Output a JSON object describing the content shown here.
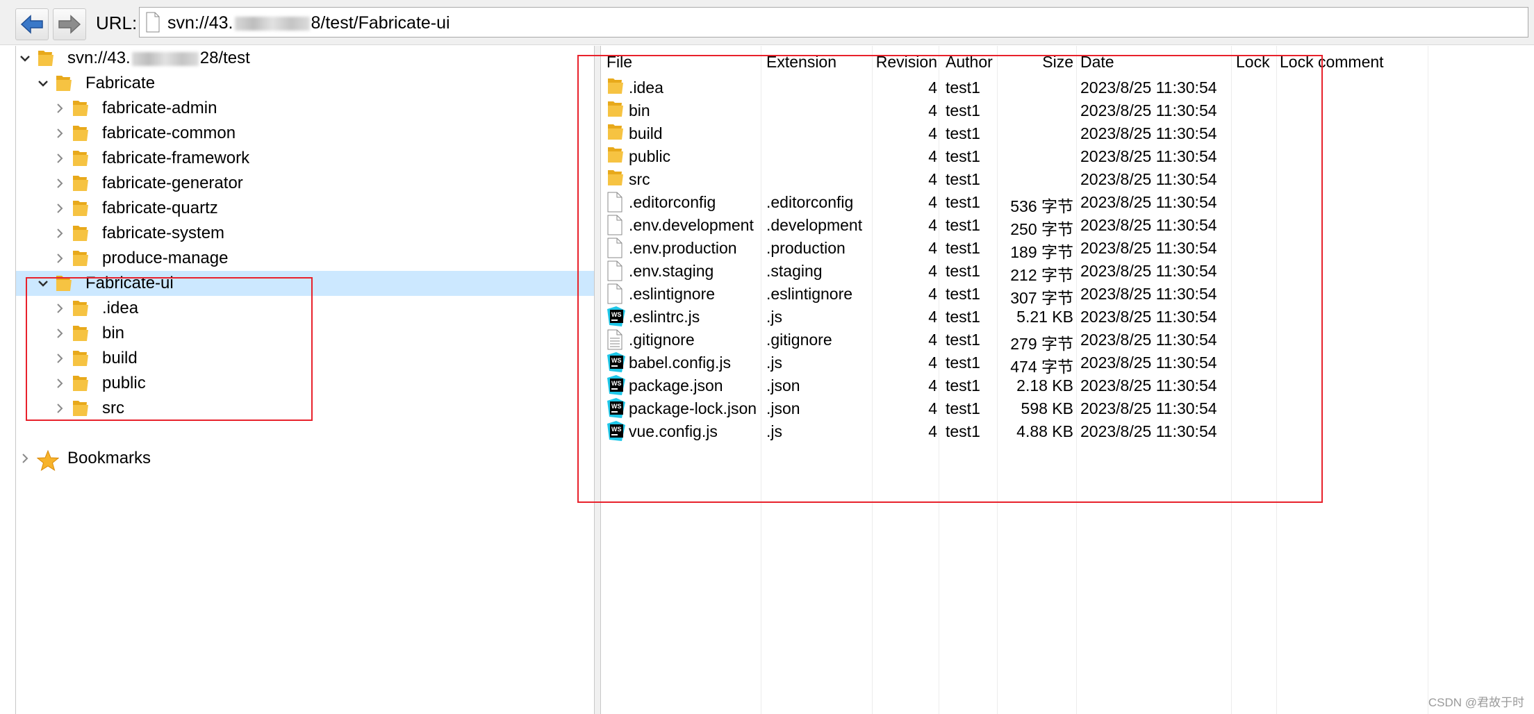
{
  "toolbar": {
    "back_icon": "arrow-left-icon",
    "forward_icon": "arrow-right-icon",
    "url_label": "URL:",
    "url_prefix": "svn://43.",
    "url_suffix": "8/test/Fabricate-ui"
  },
  "tree": {
    "root": "svn://43.",
    "root_suffix": "28/test",
    "fabricate": "Fabricate",
    "fabricate_children": [
      "fabricate-admin",
      "fabricate-common",
      "fabricate-framework",
      "fabricate-generator",
      "fabricate-quartz",
      "fabricate-system",
      "produce-manage"
    ],
    "fabricate_ui": "Fabricate-ui",
    "fabricate_ui_children": [
      ".idea",
      "bin",
      "build",
      "public",
      "src"
    ],
    "bookmarks": "Bookmarks"
  },
  "columns": {
    "file": "File",
    "extension": "Extension",
    "revision": "Revision",
    "author": "Author",
    "size": "Size",
    "date": "Date",
    "lock": "Lock",
    "lock_comment": "Lock comment"
  },
  "files": [
    {
      "icon": "folder-icon",
      "name": ".idea",
      "ext": "",
      "rev": "4",
      "author": "test1",
      "size": "",
      "date": "2023/8/25 11:30:54"
    },
    {
      "icon": "folder-icon",
      "name": "bin",
      "ext": "",
      "rev": "4",
      "author": "test1",
      "size": "",
      "date": "2023/8/25 11:30:54"
    },
    {
      "icon": "folder-icon",
      "name": "build",
      "ext": "",
      "rev": "4",
      "author": "test1",
      "size": "",
      "date": "2023/8/25 11:30:54"
    },
    {
      "icon": "folder-icon",
      "name": "public",
      "ext": "",
      "rev": "4",
      "author": "test1",
      "size": "",
      "date": "2023/8/25 11:30:54"
    },
    {
      "icon": "folder-icon",
      "name": "src",
      "ext": "",
      "rev": "4",
      "author": "test1",
      "size": "",
      "date": "2023/8/25 11:30:54"
    },
    {
      "icon": "file-icon",
      "name": ".editorconfig",
      "ext": ".editorconfig",
      "rev": "4",
      "author": "test1",
      "size": "536 字节",
      "date": "2023/8/25 11:30:54"
    },
    {
      "icon": "file-icon",
      "name": ".env.development",
      "ext": ".development",
      "rev": "4",
      "author": "test1",
      "size": "250 字节",
      "date": "2023/8/25 11:30:54"
    },
    {
      "icon": "file-icon",
      "name": ".env.production",
      "ext": ".production",
      "rev": "4",
      "author": "test1",
      "size": "189 字节",
      "date": "2023/8/25 11:30:54"
    },
    {
      "icon": "file-icon",
      "name": ".env.staging",
      "ext": ".staging",
      "rev": "4",
      "author": "test1",
      "size": "212 字节",
      "date": "2023/8/25 11:30:54"
    },
    {
      "icon": "file-icon",
      "name": ".eslintignore",
      "ext": ".eslintignore",
      "rev": "4",
      "author": "test1",
      "size": "307 字节",
      "date": "2023/8/25 11:30:54"
    },
    {
      "icon": "webstorm-icon",
      "name": ".eslintrc.js",
      "ext": ".js",
      "rev": "4",
      "author": "test1",
      "size": "5.21 KB",
      "date": "2023/8/25 11:30:54"
    },
    {
      "icon": "text-file-icon",
      "name": ".gitignore",
      "ext": ".gitignore",
      "rev": "4",
      "author": "test1",
      "size": "279 字节",
      "date": "2023/8/25 11:30:54"
    },
    {
      "icon": "webstorm-icon",
      "name": "babel.config.js",
      "ext": ".js",
      "rev": "4",
      "author": "test1",
      "size": "474 字节",
      "date": "2023/8/25 11:30:54"
    },
    {
      "icon": "webstorm-icon",
      "name": "package.json",
      "ext": ".json",
      "rev": "4",
      "author": "test1",
      "size": "2.18 KB",
      "date": "2023/8/25 11:30:54"
    },
    {
      "icon": "webstorm-icon",
      "name": "package-lock.json",
      "ext": ".json",
      "rev": "4",
      "author": "test1",
      "size": "598 KB",
      "date": "2023/8/25 11:30:54"
    },
    {
      "icon": "webstorm-icon",
      "name": "vue.config.js",
      "ext": ".js",
      "rev": "4",
      "author": "test1",
      "size": "4.88 KB",
      "date": "2023/8/25 11:30:54"
    }
  ],
  "watermark": "CSDN @君故于时",
  "colors": {
    "selection": "#cce8ff",
    "highlight_box": "#e8212b",
    "folder": "#f6c342",
    "back_arrow": "#3a78c8"
  }
}
